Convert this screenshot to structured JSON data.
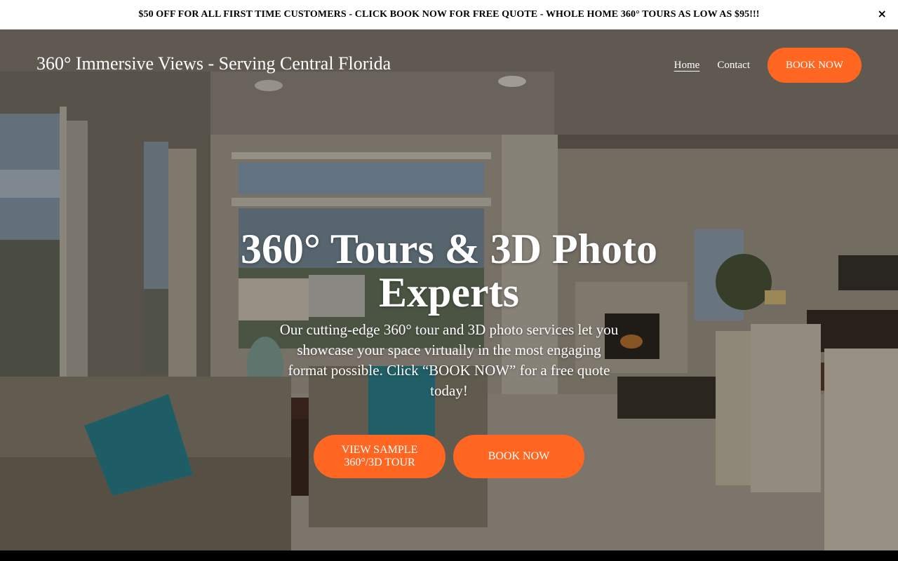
{
  "announcement": {
    "text": "$50 OFF FOR ALL FIRST TIME CUSTOMERS - CLICK BOOK NOW FOR FREE QUOTE - WHOLE HOME 360° TOURS AS LOW AS $95!!!",
    "close_label": "×"
  },
  "header": {
    "site_title": "360° Immersive Views - Serving Central Florida",
    "nav": {
      "home": "Home",
      "contact": "Contact",
      "book_now": "BOOK NOW"
    }
  },
  "hero": {
    "headline": "360° Tours & 3D Photo Experts",
    "subtext": "Our cutting-edge 360° tour and 3D photo services let you showcase your space virtually in the most engaging format possible. Click “BOOK NOW” for a free quote today!",
    "cta_primary": "VIEW SAMPLE 360°/3D TOUR",
    "cta_secondary": "BOOK NOW"
  },
  "colors": {
    "accent": "#ff6622",
    "announcement_bg": "#ffffff",
    "text_on_hero": "#ffffff"
  }
}
